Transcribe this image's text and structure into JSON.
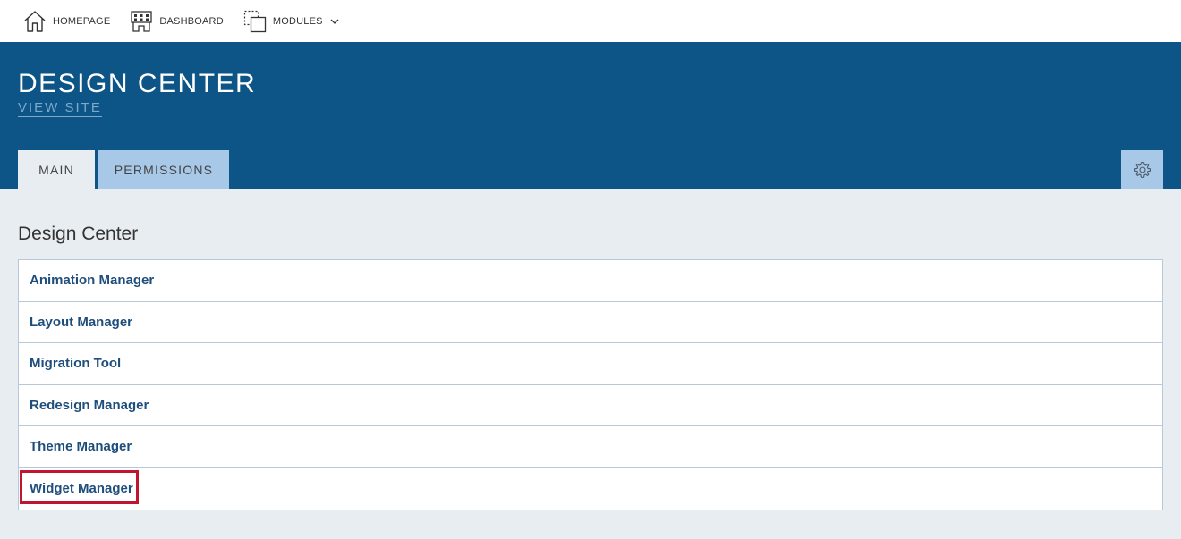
{
  "topnav": {
    "homepage": "HOMEPAGE",
    "dashboard": "DASHBOARD",
    "modules": "MODULES"
  },
  "header": {
    "title": "DESIGN CENTER",
    "view_site": "VIEW SITE"
  },
  "tabs": [
    {
      "label": "MAIN",
      "active": true
    },
    {
      "label": "PERMISSIONS",
      "active": false
    }
  ],
  "section_title": "Design Center",
  "items": [
    {
      "label": "Animation Manager"
    },
    {
      "label": "Layout Manager"
    },
    {
      "label": "Migration Tool"
    },
    {
      "label": "Redesign Manager"
    },
    {
      "label": "Theme Manager"
    },
    {
      "label": "Widget Manager",
      "highlighted": true
    }
  ],
  "icons": {
    "homepage": "home-icon",
    "dashboard": "dashboard-icon",
    "modules": "modules-icon",
    "modules_dropdown": "chevron-down-icon",
    "settings": "gear-icon"
  },
  "colors": {
    "header_bg": "#0d5586",
    "tab_inactive": "#a8c8e8",
    "link": "#1e4e7c",
    "highlight": "#c0152f"
  }
}
